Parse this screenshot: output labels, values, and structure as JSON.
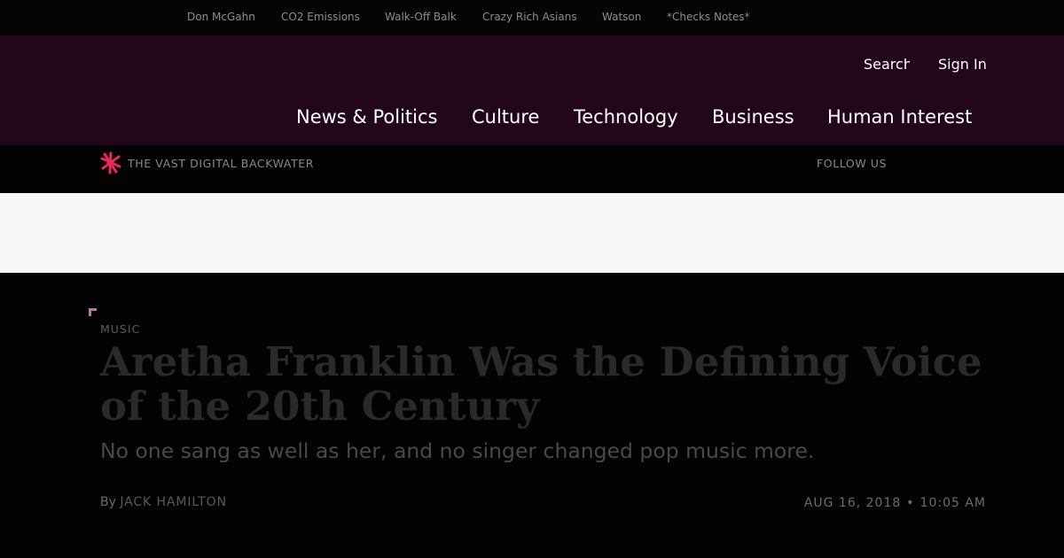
{
  "trending": [
    "Don McGahn",
    "CO2 Emissions",
    "Walk-Off Balk",
    "Crazy Rich Asians",
    "Watson",
    "*Checks Notes*"
  ],
  "header": {
    "search_label": "Search",
    "signin_label": "Sign In"
  },
  "nav": [
    "News & Politics",
    "Culture",
    "Technology",
    "Business",
    "Human Interest"
  ],
  "subbar": {
    "logo_icon": "asterisk-logo-icon",
    "tagline": "THE VAST DIGITAL BACKWATER",
    "follow_label": "FOLLOW US"
  },
  "article": {
    "kicker": "MUSIC",
    "headline": "Aretha Franklin Was the Defining Voice of the 20th Century",
    "dek": "No one sang as well as her, and no singer changed pop music more.",
    "byline_prefix": "By",
    "author": "JACK HAMILTON",
    "date": "AUG 16, 2018",
    "separator": "•",
    "time": "10:05 AM"
  },
  "colors": {
    "masthead_bg": "#22061a",
    "accent": "#e8285a",
    "page_bg": "#040304",
    "ad_bg": "#f7f7f7"
  }
}
